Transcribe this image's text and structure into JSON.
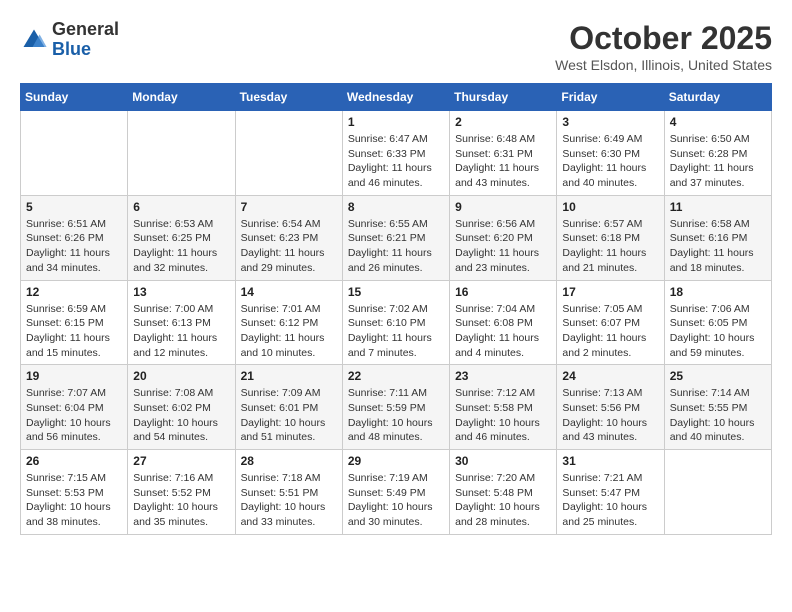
{
  "app": {
    "name_general": "General",
    "name_blue": "Blue"
  },
  "header": {
    "month": "October 2025",
    "location": "West Elsdon, Illinois, United States"
  },
  "weekdays": [
    "Sunday",
    "Monday",
    "Tuesday",
    "Wednesday",
    "Thursday",
    "Friday",
    "Saturday"
  ],
  "weeks": [
    [
      {
        "day": null
      },
      {
        "day": null
      },
      {
        "day": null
      },
      {
        "day": "1",
        "sunrise": "6:47 AM",
        "sunset": "6:33 PM",
        "daylight": "11 hours and 46 minutes."
      },
      {
        "day": "2",
        "sunrise": "6:48 AM",
        "sunset": "6:31 PM",
        "daylight": "11 hours and 43 minutes."
      },
      {
        "day": "3",
        "sunrise": "6:49 AM",
        "sunset": "6:30 PM",
        "daylight": "11 hours and 40 minutes."
      },
      {
        "day": "4",
        "sunrise": "6:50 AM",
        "sunset": "6:28 PM",
        "daylight": "11 hours and 37 minutes."
      }
    ],
    [
      {
        "day": "5",
        "sunrise": "6:51 AM",
        "sunset": "6:26 PM",
        "daylight": "11 hours and 34 minutes."
      },
      {
        "day": "6",
        "sunrise": "6:53 AM",
        "sunset": "6:25 PM",
        "daylight": "11 hours and 32 minutes."
      },
      {
        "day": "7",
        "sunrise": "6:54 AM",
        "sunset": "6:23 PM",
        "daylight": "11 hours and 29 minutes."
      },
      {
        "day": "8",
        "sunrise": "6:55 AM",
        "sunset": "6:21 PM",
        "daylight": "11 hours and 26 minutes."
      },
      {
        "day": "9",
        "sunrise": "6:56 AM",
        "sunset": "6:20 PM",
        "daylight": "11 hours and 23 minutes."
      },
      {
        "day": "10",
        "sunrise": "6:57 AM",
        "sunset": "6:18 PM",
        "daylight": "11 hours and 21 minutes."
      },
      {
        "day": "11",
        "sunrise": "6:58 AM",
        "sunset": "6:16 PM",
        "daylight": "11 hours and 18 minutes."
      }
    ],
    [
      {
        "day": "12",
        "sunrise": "6:59 AM",
        "sunset": "6:15 PM",
        "daylight": "11 hours and 15 minutes."
      },
      {
        "day": "13",
        "sunrise": "7:00 AM",
        "sunset": "6:13 PM",
        "daylight": "11 hours and 12 minutes."
      },
      {
        "day": "14",
        "sunrise": "7:01 AM",
        "sunset": "6:12 PM",
        "daylight": "11 hours and 10 minutes."
      },
      {
        "day": "15",
        "sunrise": "7:02 AM",
        "sunset": "6:10 PM",
        "daylight": "11 hours and 7 minutes."
      },
      {
        "day": "16",
        "sunrise": "7:04 AM",
        "sunset": "6:08 PM",
        "daylight": "11 hours and 4 minutes."
      },
      {
        "day": "17",
        "sunrise": "7:05 AM",
        "sunset": "6:07 PM",
        "daylight": "11 hours and 2 minutes."
      },
      {
        "day": "18",
        "sunrise": "7:06 AM",
        "sunset": "6:05 PM",
        "daylight": "10 hours and 59 minutes."
      }
    ],
    [
      {
        "day": "19",
        "sunrise": "7:07 AM",
        "sunset": "6:04 PM",
        "daylight": "10 hours and 56 minutes."
      },
      {
        "day": "20",
        "sunrise": "7:08 AM",
        "sunset": "6:02 PM",
        "daylight": "10 hours and 54 minutes."
      },
      {
        "day": "21",
        "sunrise": "7:09 AM",
        "sunset": "6:01 PM",
        "daylight": "10 hours and 51 minutes."
      },
      {
        "day": "22",
        "sunrise": "7:11 AM",
        "sunset": "5:59 PM",
        "daylight": "10 hours and 48 minutes."
      },
      {
        "day": "23",
        "sunrise": "7:12 AM",
        "sunset": "5:58 PM",
        "daylight": "10 hours and 46 minutes."
      },
      {
        "day": "24",
        "sunrise": "7:13 AM",
        "sunset": "5:56 PM",
        "daylight": "10 hours and 43 minutes."
      },
      {
        "day": "25",
        "sunrise": "7:14 AM",
        "sunset": "5:55 PM",
        "daylight": "10 hours and 40 minutes."
      }
    ],
    [
      {
        "day": "26",
        "sunrise": "7:15 AM",
        "sunset": "5:53 PM",
        "daylight": "10 hours and 38 minutes."
      },
      {
        "day": "27",
        "sunrise": "7:16 AM",
        "sunset": "5:52 PM",
        "daylight": "10 hours and 35 minutes."
      },
      {
        "day": "28",
        "sunrise": "7:18 AM",
        "sunset": "5:51 PM",
        "daylight": "10 hours and 33 minutes."
      },
      {
        "day": "29",
        "sunrise": "7:19 AM",
        "sunset": "5:49 PM",
        "daylight": "10 hours and 30 minutes."
      },
      {
        "day": "30",
        "sunrise": "7:20 AM",
        "sunset": "5:48 PM",
        "daylight": "10 hours and 28 minutes."
      },
      {
        "day": "31",
        "sunrise": "7:21 AM",
        "sunset": "5:47 PM",
        "daylight": "10 hours and 25 minutes."
      },
      {
        "day": null
      }
    ]
  ]
}
